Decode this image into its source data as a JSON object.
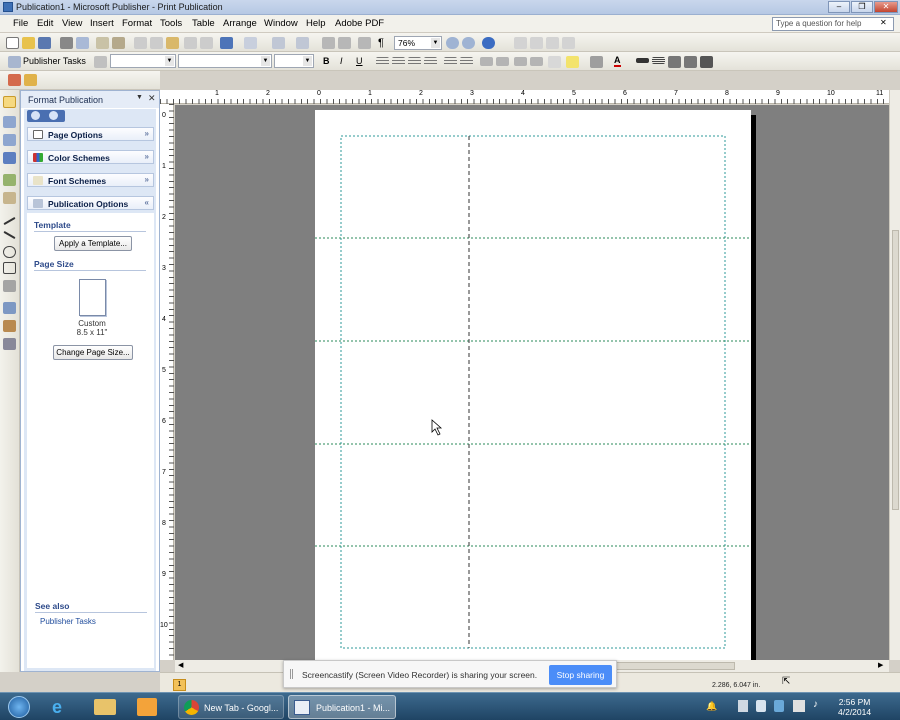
{
  "window": {
    "title": "Publication1 - Microsoft Publisher - Print Publication"
  },
  "menu": [
    "File",
    "Edit",
    "View",
    "Insert",
    "Format",
    "Tools",
    "Table",
    "Arrange",
    "Window",
    "Help",
    "Adobe PDF"
  ],
  "ask_placeholder": "Type a question for help",
  "toolbar": {
    "zoom": "76%",
    "publisher_tasks": "Publisher Tasks"
  },
  "task_pane": {
    "title": "Format Publication",
    "sections": [
      "Page Options",
      "Color Schemes",
      "Font Schemes",
      "Publication Options"
    ],
    "template_heading": "Template",
    "apply_template": "Apply a Template...",
    "page_size_heading": "Page Size",
    "page_size_name": "Custom",
    "page_size_dims": "8.5 x 11\"",
    "change_page_size": "Change Page Size...",
    "see_also": "See also",
    "see_also_link": "Publisher Tasks"
  },
  "ruler_h_labels": [
    "1",
    "2",
    "1",
    "0",
    "1",
    "2",
    "3",
    "4",
    "5",
    "6",
    "7",
    "8",
    "9",
    "10",
    "11"
  ],
  "ruler_v_labels": [
    "0",
    "1",
    "2",
    "3",
    "4",
    "5",
    "6",
    "7",
    "8",
    "9",
    "10"
  ],
  "status": {
    "page_number": "1",
    "position": "2.286, 6.047 in."
  },
  "share_bar": {
    "message": "Screencastify (Screen Video Recorder) is sharing your screen.",
    "stop_label": "Stop sharing"
  },
  "taskbar": {
    "apps": [
      "New Tab - Googl...",
      "Publication1 - Mi..."
    ],
    "time": "2:56 PM",
    "date": "4/2/2014"
  }
}
